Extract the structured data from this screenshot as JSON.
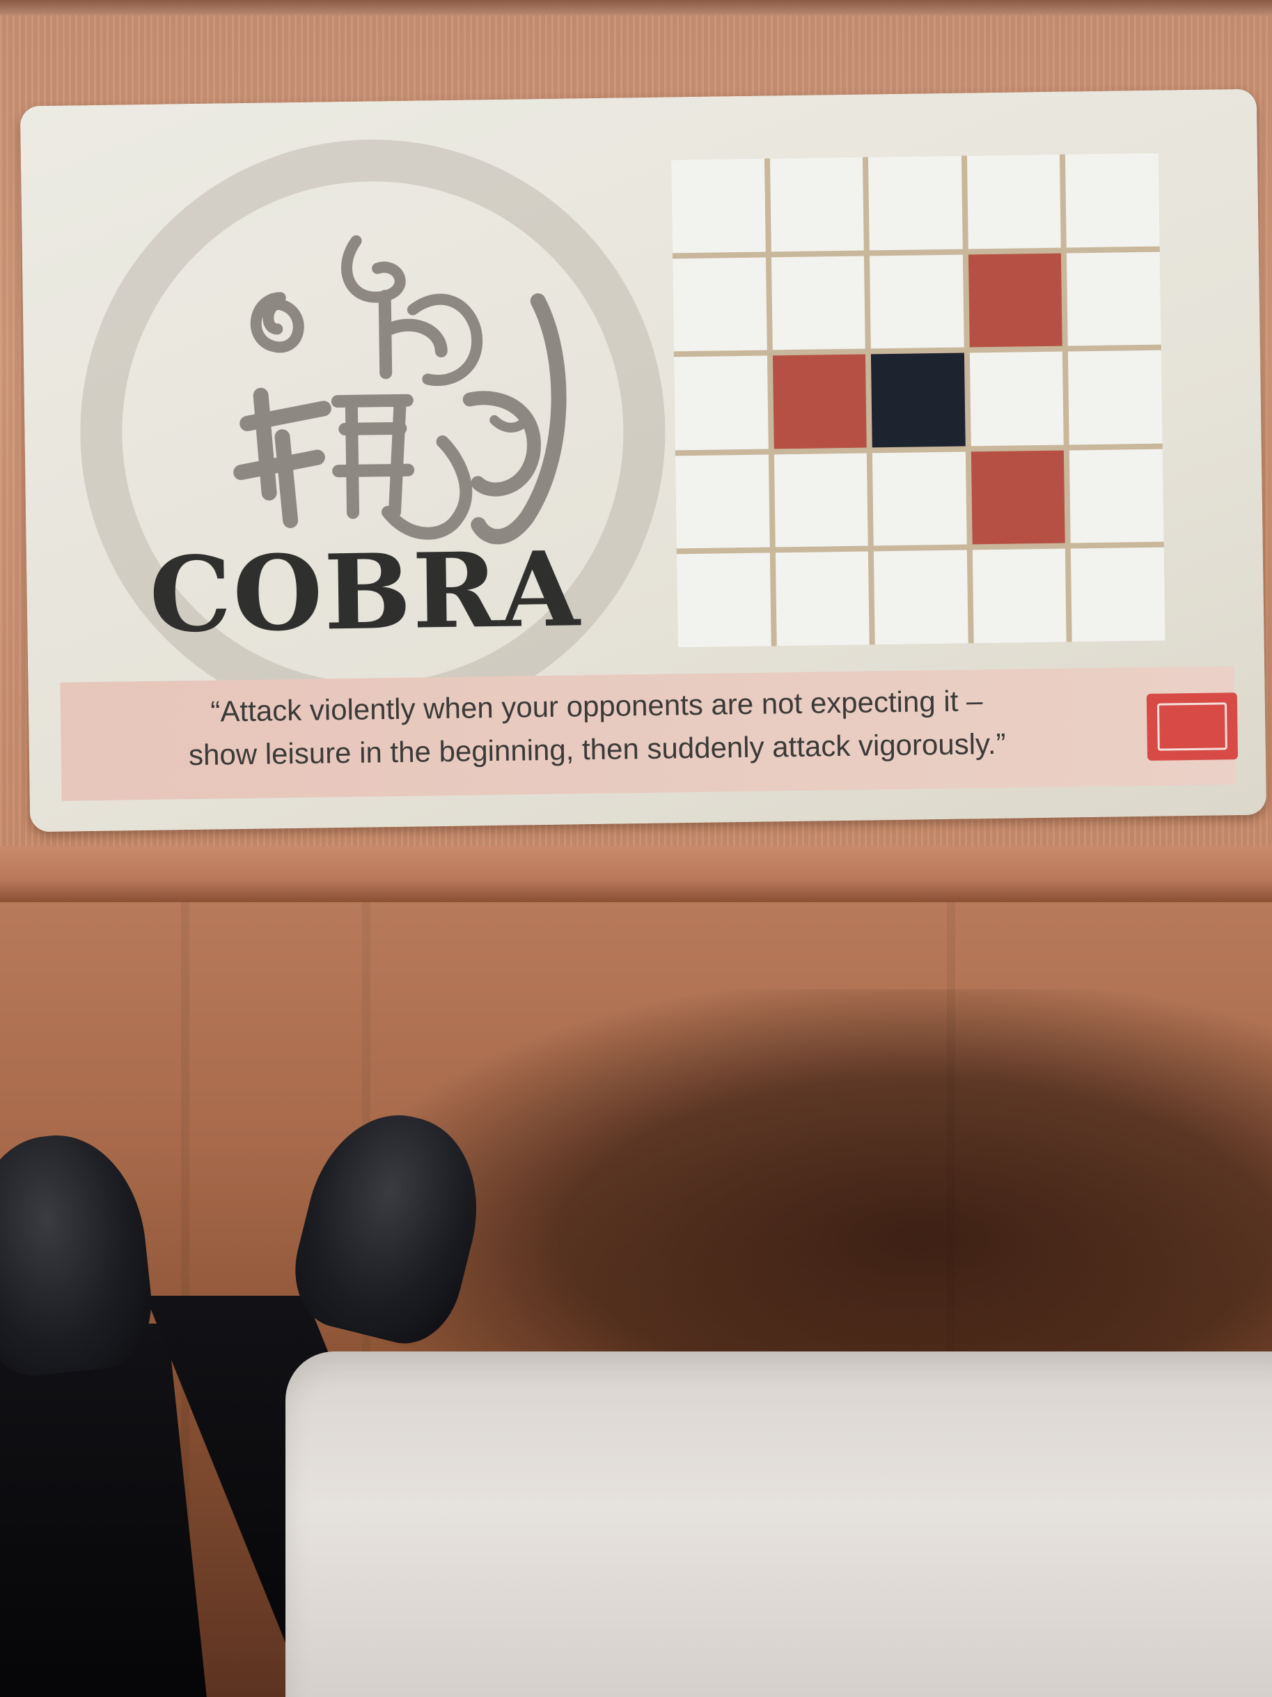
{
  "card": {
    "title": "COBRA",
    "quote_line1": "“Attack violently when your opponents are not expecting it –",
    "quote_line2": "show leisure in the beginning, then suddenly attack vigorously.”",
    "logo_icon": "publisher-logo-icon",
    "emblem_icon": "calligraphy-emblem-icon"
  },
  "move_grid": {
    "rows": 5,
    "cols": 5,
    "cells": [
      [
        "empty",
        "empty",
        "empty",
        "empty",
        "empty"
      ],
      [
        "empty",
        "empty",
        "empty",
        "attack",
        "empty"
      ],
      [
        "empty",
        "attack",
        "center",
        "empty",
        "empty"
      ],
      [
        "empty",
        "empty",
        "empty",
        "attack",
        "empty"
      ],
      [
        "empty",
        "empty",
        "empty",
        "empty",
        "empty"
      ]
    ]
  },
  "colors": {
    "attack": "#b65044",
    "center": "#1e2330",
    "empty": "#f2f2ef",
    "logo": "#d84a45"
  }
}
